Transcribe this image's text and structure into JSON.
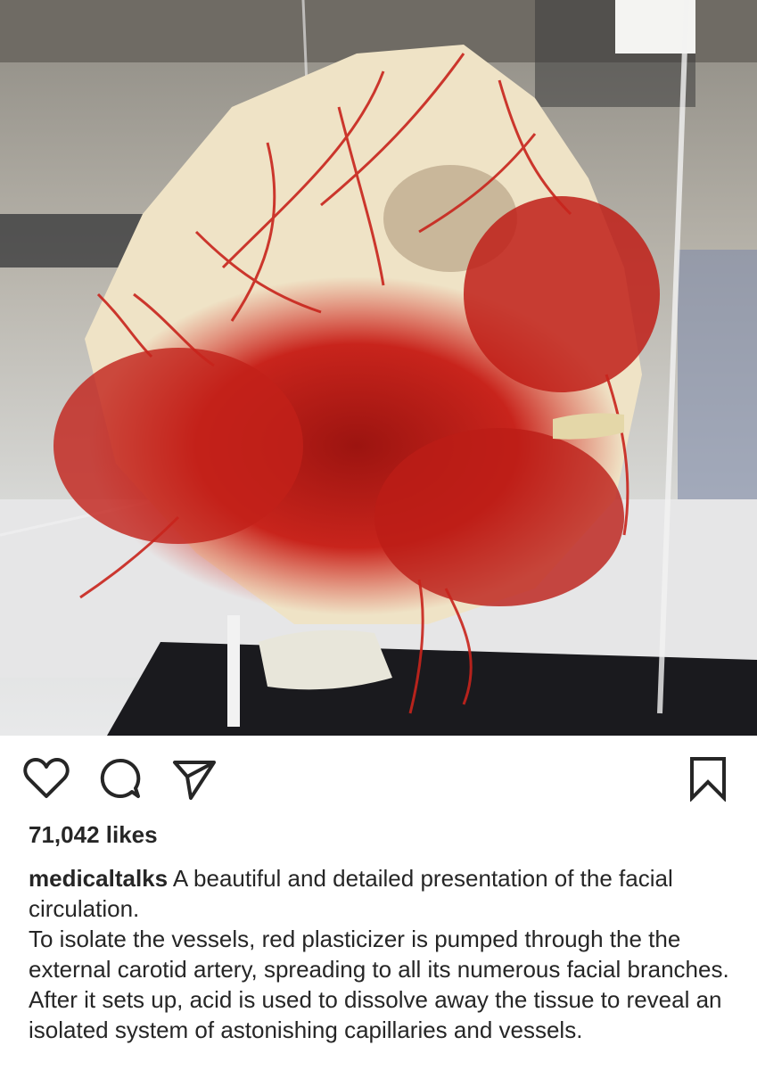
{
  "post": {
    "image": {
      "subject_icon": "anatomical-vascular-cast-photo"
    },
    "actions": {
      "like_icon": "heart-icon",
      "comment_icon": "comment-icon",
      "share_icon": "send-icon",
      "save_icon": "bookmark-icon"
    },
    "likes_text": "71,042 likes",
    "caption": {
      "username": "medicaltalks",
      "first_line": "A beautiful and detailed presentation of the facial circulation.",
      "body": "To isolate the vessels, red plasticizer is pumped through the the external carotid artery, spreading to all its numerous facial branches. After it sets up, acid is used to dissolve away the tissue to reveal an isolated system of astonishing capillaries and vessels."
    }
  },
  "colors": {
    "text": "#262626",
    "vessel_red": "#c8241c",
    "bone": "#efe3c6"
  }
}
